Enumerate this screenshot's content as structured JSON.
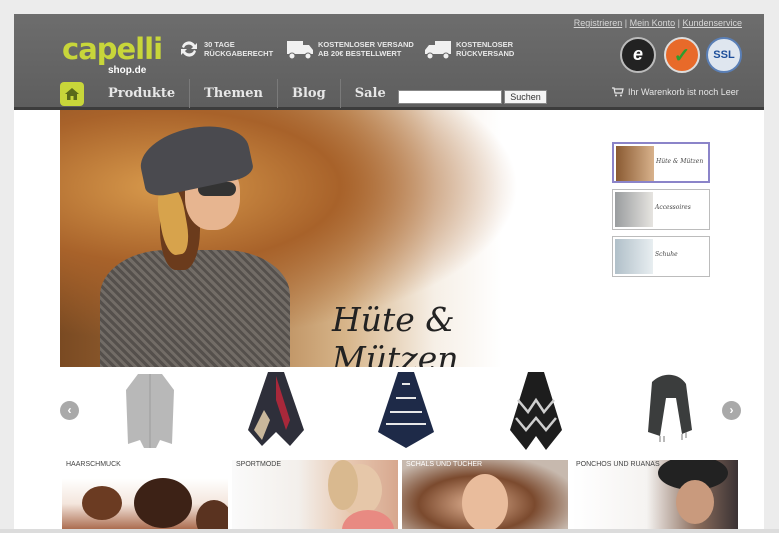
{
  "header": {
    "logo_main": "capelli",
    "logo_sub": "shop.de",
    "usps": [
      {
        "line1": "30 TAGE",
        "line2": "RÜCKGABERECHT",
        "icon": "return-arrows-icon"
      },
      {
        "line1": "KOSTENLOSER VERSAND",
        "line2": "AB 20€ BESTELLWERT",
        "icon": "truck-icon"
      },
      {
        "line1": "KOSTENLOSER",
        "line2": "RÜCKVERSAND",
        "icon": "truck-return-icon"
      }
    ],
    "toplinks": [
      "Registrieren",
      "Mein Konto",
      "Kundenservice"
    ],
    "toplink_sep": " | ",
    "nav": [
      "Produkte",
      "Themen",
      "Blog",
      "Sale"
    ],
    "search_button": "Suchen",
    "search_value": "",
    "cart_text": "Ihr Warenkorb ist noch Leer",
    "badges": [
      {
        "icon": "trusted-shops-icon",
        "label": "e"
      },
      {
        "icon": "check-badge-icon",
        "label": "✓"
      },
      {
        "icon": "ssl-badge-icon",
        "label": "SSL"
      }
    ]
  },
  "hero": {
    "title": "Hüte & Mützen"
  },
  "thumbnails": [
    {
      "label": "Hüte & Mützen"
    },
    {
      "label": "Accessoires"
    },
    {
      "label": "Schuhe"
    }
  ],
  "categories": [
    {
      "label": "HAARSCHMUCK"
    },
    {
      "label": "SPORTMODE"
    },
    {
      "label": "SCHALS UND TÜCHER"
    },
    {
      "label": "PONCHOS UND RUANAS"
    }
  ],
  "colors": {
    "accent": "#c8d63a",
    "header_bg": "#666666",
    "thumb_active_border": "#8b84c9"
  }
}
